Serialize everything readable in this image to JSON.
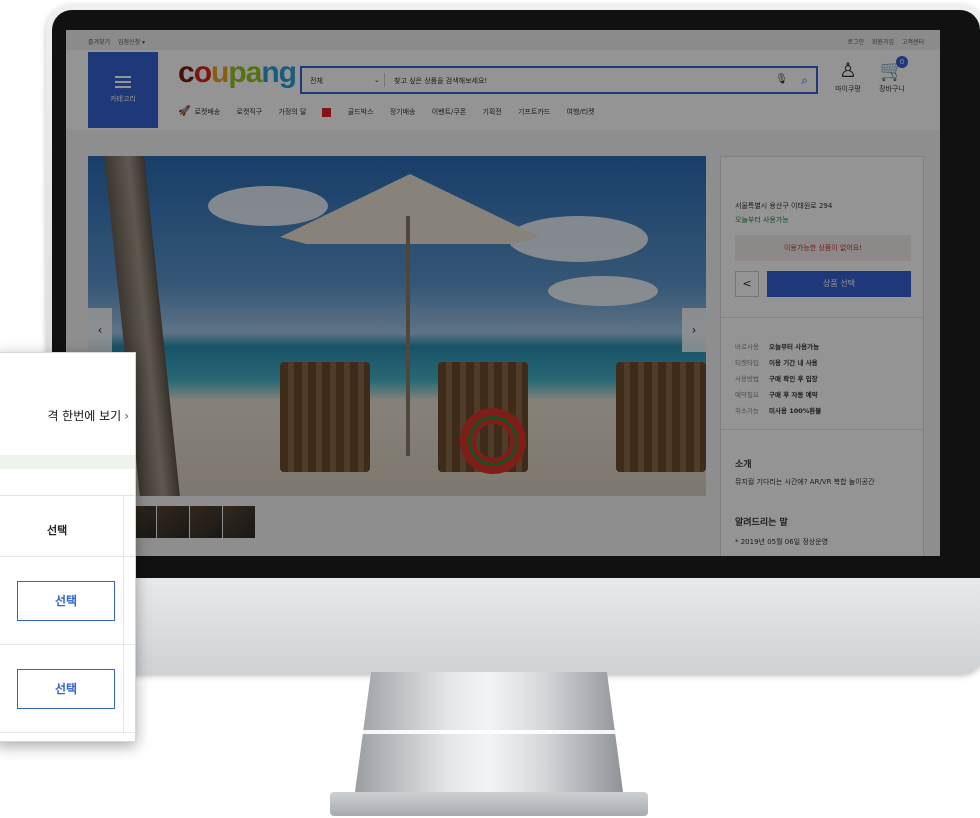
{
  "topbar": {
    "left": [
      "즐겨찾기",
      "입점신청 ▾"
    ],
    "right": [
      "로그인",
      "회원가입",
      "고객센터"
    ]
  },
  "header": {
    "category_label": "카테고리",
    "logo_parts": [
      "c",
      "o",
      "u",
      "pa",
      "ng"
    ],
    "search": {
      "category": "전체",
      "placeholder": "찾고 싶은 상품을 검색해보세요!"
    },
    "mypage_label": "마이쿠팡",
    "cart_label": "장바구니",
    "cart_count": "0",
    "nav": [
      "로켓배송",
      "로켓직구",
      "가정의 달",
      "골드박스",
      "정기배송",
      "이벤트/쿠폰",
      "기획전",
      "기프트카드",
      "여행/티켓"
    ]
  },
  "panel": {
    "address": "서울특별시 용산구 이태원로 294",
    "available_from": "오늘부터 사용가능",
    "no_items": "이용가능한 상품이 없어요!",
    "select_button": "상품 선택",
    "info": [
      {
        "k": "바로사용",
        "v": "오늘부터 사용가능"
      },
      {
        "k": "티켓타입",
        "v": "이용 기간 내 사용"
      },
      {
        "k": "사용방법",
        "v": "구매 확인 후 입장"
      },
      {
        "k": "예약필요",
        "v": "구매 후 자동 예약"
      },
      {
        "k": "취소가능",
        "v": "미사용 100%환불"
      }
    ],
    "intro_title": "소개",
    "intro_text": "뮤지컬 기다리는 시간에? AR/VR 복합 놀이공간",
    "notice_title": "알려드리는 말",
    "notice_text": "* 2019년 05월 06일 정상운영"
  },
  "popup": {
    "price_link": "격 한번에 보기",
    "column_header": "선택",
    "row_buttons": [
      "선택",
      "선택"
    ]
  },
  "colors": {
    "brand_blue": "#3461d2",
    "cart_badge": "#3461d2",
    "red_tag": "#e4222c"
  }
}
